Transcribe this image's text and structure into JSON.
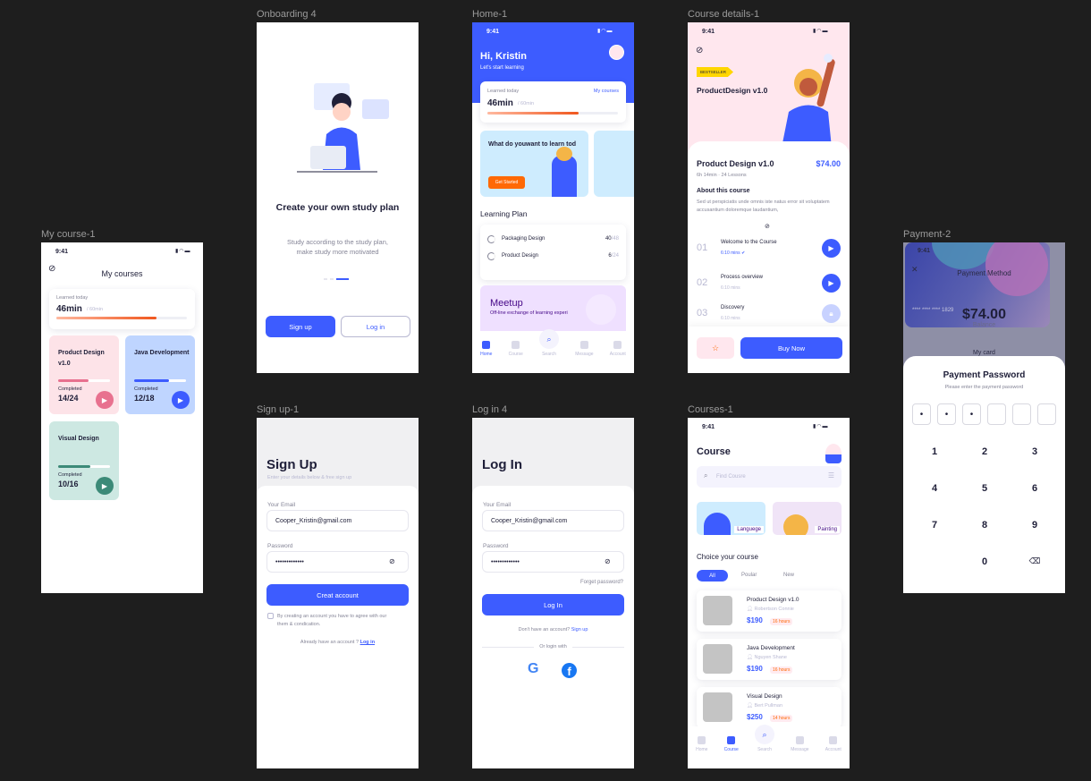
{
  "frames": {
    "my_course": "My course-1",
    "onboarding": "Onboarding 4",
    "home": "Home-1",
    "details": "Course details-1",
    "payment": "Payment-2",
    "signup": "Sign up-1",
    "login": "Log in 4",
    "courses": "Courses-1"
  },
  "status_time": "9:41",
  "my_course": {
    "title": "My courses",
    "learned_label": "Learned today",
    "learned_value": "46min",
    "learned_goal": "/ 60min",
    "learned_progress": 0.77,
    "cards": [
      {
        "title": "Product Design v1.0",
        "completed_label": "Completed",
        "value": "14/24",
        "progress": 0.58,
        "color": "#FDE3E8",
        "accent": "#E8718F"
      },
      {
        "title": "Java Development",
        "completed_label": "Completed",
        "value": "12/18",
        "progress": 0.67,
        "color": "#BFD5FF",
        "accent": "#3D5CFF"
      },
      {
        "title": "Visual Design",
        "completed_label": "Completed",
        "value": "10/16",
        "progress": 0.62,
        "color": "#CDE8E2",
        "accent": "#3C8A78"
      }
    ]
  },
  "onboarding": {
    "title": "Create your own study plan",
    "description": "Study according to the study plan, make study more motivated",
    "signup": "Sign up",
    "login": "Log in",
    "page": 3,
    "pages": 3
  },
  "home": {
    "greeting": "Hi, Kristin",
    "subtitle": "Let's start learning",
    "learned_label": "Learned today",
    "my_courses": "My courses",
    "learned_value": "46min",
    "learned_goal": "/ 60min",
    "learned_progress": 0.77,
    "banner_title": "What do youwant to learn tod",
    "banner_button": "Get Started",
    "plan_title": "Learning Plan",
    "plan": [
      {
        "name": "Packaging Design",
        "done": "40",
        "total": "/48"
      },
      {
        "name": "Product Design",
        "done": "6",
        "total": "/24"
      }
    ],
    "meetup_title": "Meetup",
    "meetup_subtitle": "Off-line exchange of learning experi"
  },
  "nav": [
    "Home",
    "Course",
    "Search",
    "Message",
    "Account"
  ],
  "details": {
    "badge": "BESTSELLER",
    "hero_title": "ProductDesign v1.0",
    "title": "Product Design v1.0",
    "price": "$74.00",
    "meta": "6h 14min · 24 Lessons",
    "about_title": "About this course",
    "about": "Sed ut perspiciatis unde omnis iste natus error sit voluptatem accusantium doloremque laudantium,",
    "lessons": [
      {
        "num": "01",
        "title": "Welcome to the Course",
        "duration": "6:10  mins",
        "state": "done"
      },
      {
        "num": "02",
        "title": "Process overview",
        "duration": "6:10  mins",
        "state": "play"
      },
      {
        "num": "03",
        "title": "Discovery",
        "duration": "6:10  mins",
        "state": "locked"
      }
    ],
    "buy": "Buy Now"
  },
  "payment": {
    "title": "Payment Method",
    "card_number": "**** **** **** 1829",
    "balance": "$74.00",
    "balance_label": "Balance",
    "my_card": "My card",
    "sheet_title": "Payment Password",
    "sheet_subtitle": "Please enter the payment password",
    "filled": 3,
    "digits": 6,
    "keys": [
      "1",
      "2",
      "3",
      "4",
      "5",
      "6",
      "7",
      "8",
      "9",
      "",
      "0",
      "⌫"
    ]
  },
  "signup": {
    "title": "Sign Up",
    "subtitle": "Enter your details below & free sign up",
    "email_label": "Your  Email",
    "email": "Cooper_Kristin@gmail.com",
    "password_label": "Password",
    "password": "•••••••••••••",
    "button": "Creat account",
    "terms": "By creating an account you have to agree with our them & condication.",
    "already": "Already have an account ?",
    "login_link": "Log in"
  },
  "login": {
    "title": "Log In",
    "email_label": "Your  Email",
    "email": "Cooper_Kristin@gmail.com",
    "password_label": "Password",
    "password": "•••••••••••••",
    "forgot": "Forget password?",
    "button": "Log In",
    "no_account": "Don't have an account?",
    "signup_link": "Sign up",
    "or": "Or login with"
  },
  "courses": {
    "title": "Course",
    "search_placeholder": "Find Cousre",
    "categories": [
      "Languege",
      "Painting"
    ],
    "choice_title": "Choice your course",
    "tabs": [
      "All",
      "Poular",
      "New"
    ],
    "items": [
      {
        "title": "Product Design v1.0",
        "author": "Robertson Connie",
        "price": "$190",
        "hours": "16 hours"
      },
      {
        "title": "Java Development",
        "author": "Nguyen Shane",
        "price": "$190",
        "hours": "16 hours"
      },
      {
        "title": "Visual Design",
        "author": "Bert Pullman",
        "price": "$250",
        "hours": "14 hours"
      }
    ]
  }
}
